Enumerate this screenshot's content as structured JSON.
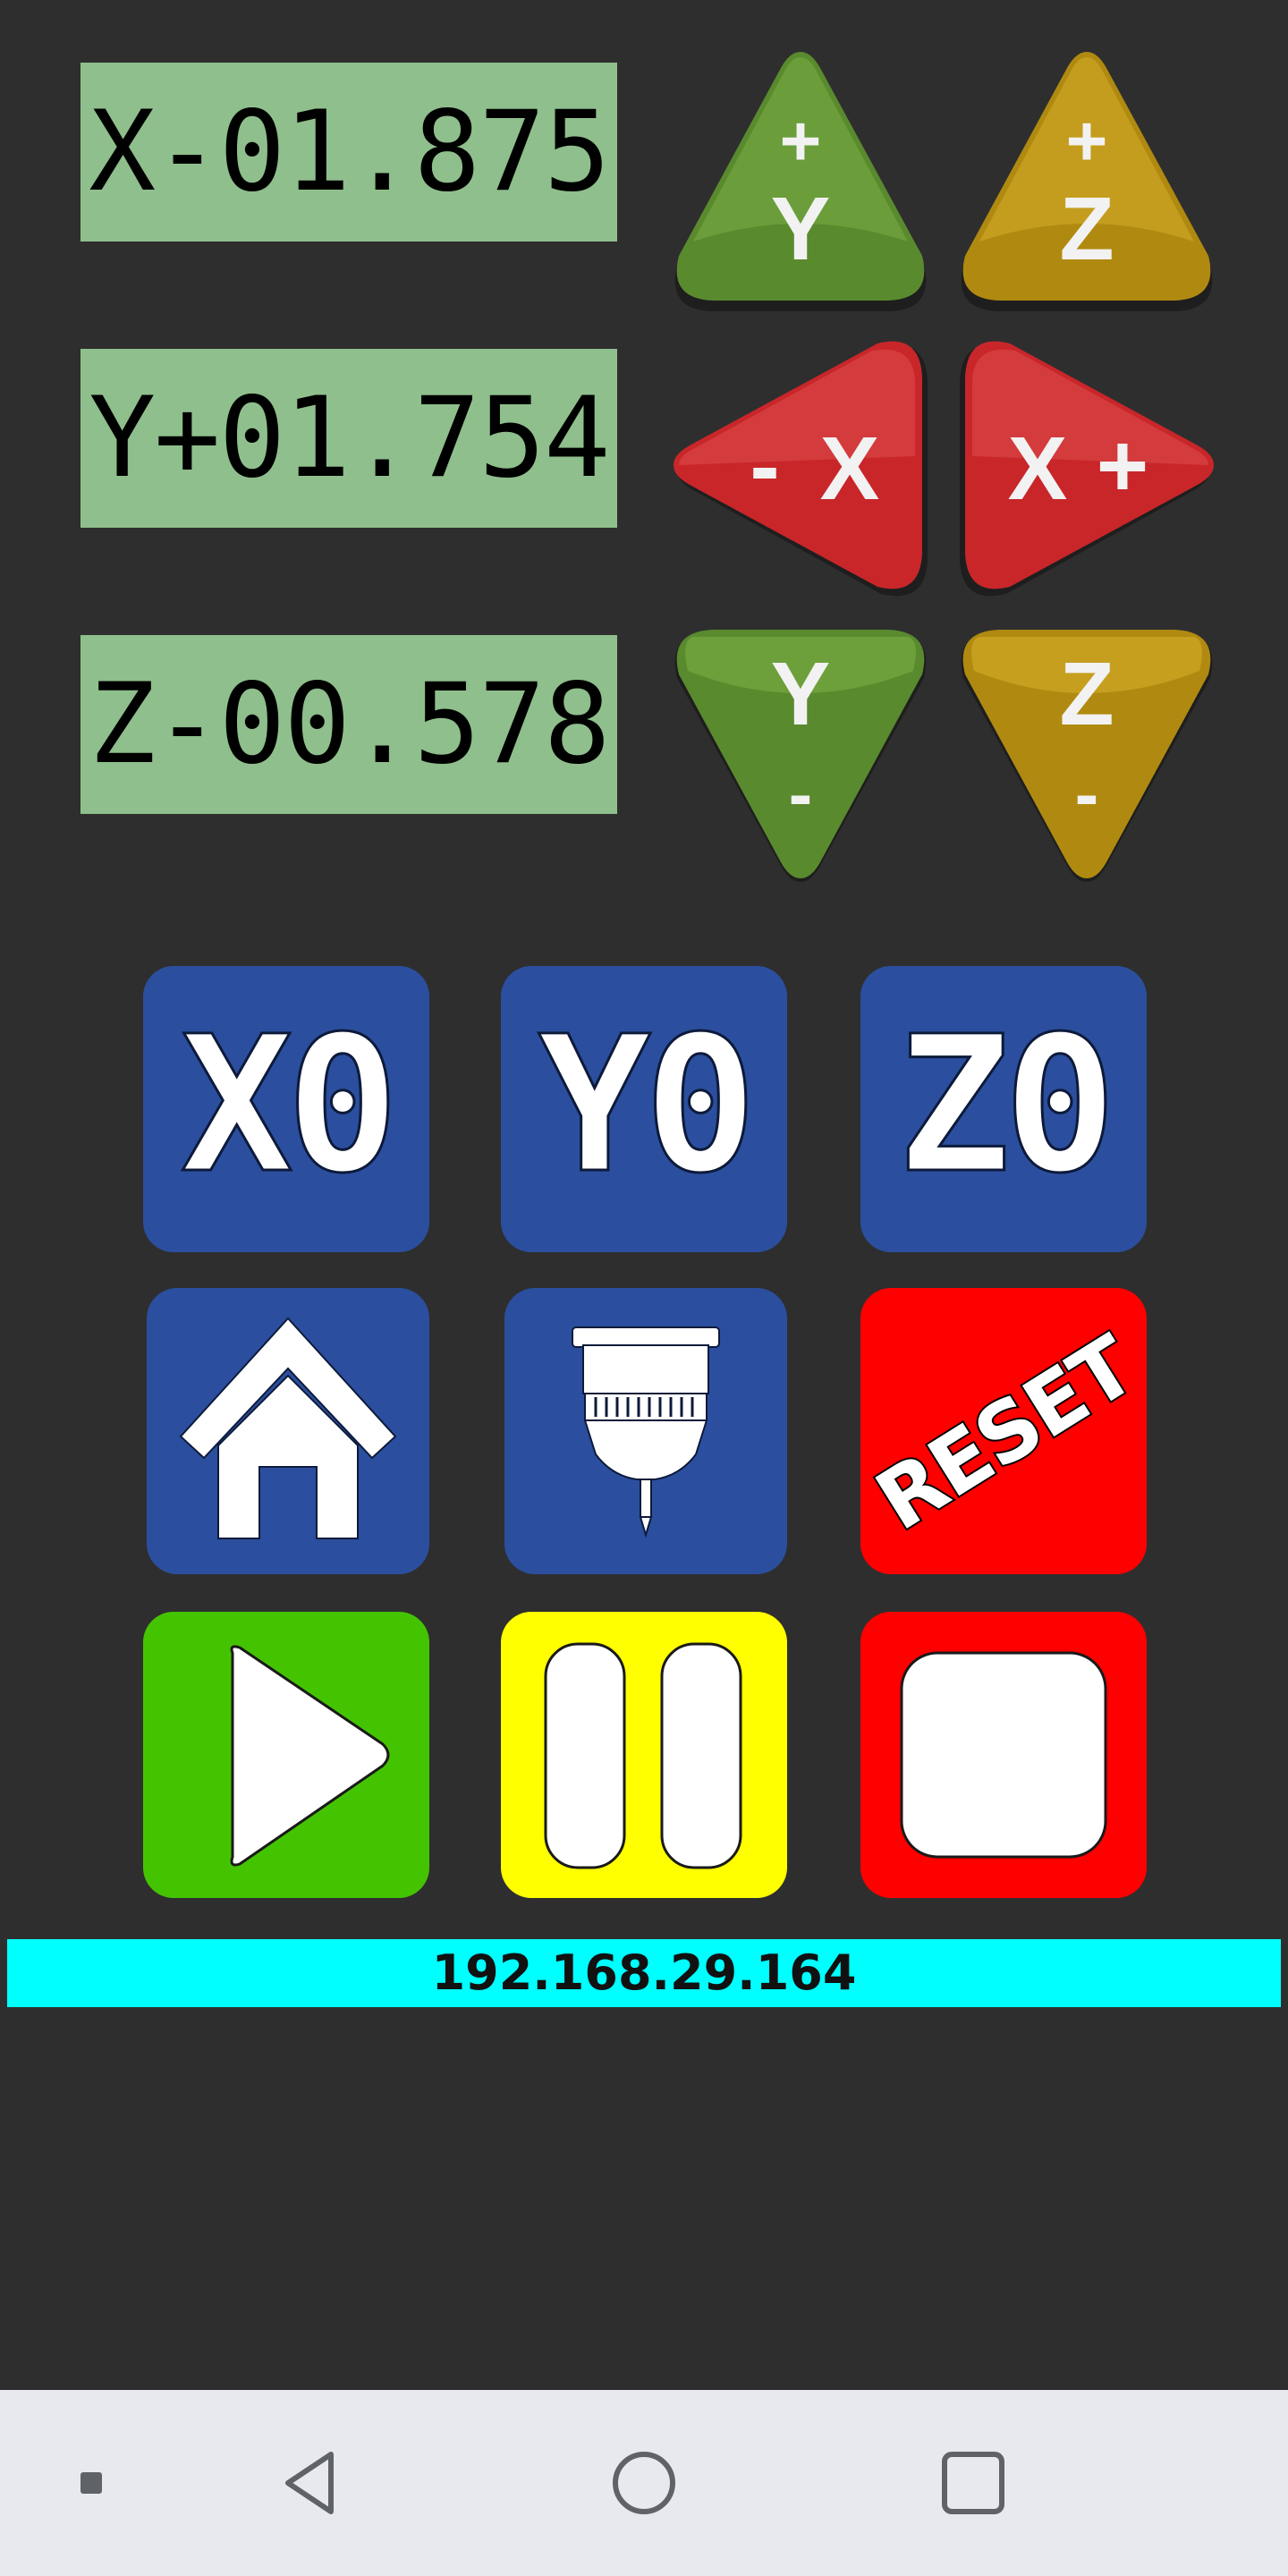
{
  "readouts": {
    "x": "X-01.875",
    "y": "Y+01.754",
    "z": "Z-00.578"
  },
  "jog": {
    "y_plus": {
      "sign": "+",
      "axis": "Y",
      "color": "#5a8a2e"
    },
    "z_plus": {
      "sign": "+",
      "axis": "Z",
      "color": "#b08a10"
    },
    "x_minus": {
      "sign": "-",
      "axis": "X",
      "color": "#c9262a"
    },
    "x_plus": {
      "sign": "+",
      "axis": "X",
      "color": "#c9262a"
    },
    "y_minus": {
      "sign": "-",
      "axis": "Y",
      "color": "#5a8a2e"
    },
    "z_minus": {
      "sign": "-",
      "axis": "Z",
      "color": "#b08a10"
    }
  },
  "zero_buttons": {
    "x0": "X0",
    "y0": "Y0",
    "z0": "Z0"
  },
  "actions": {
    "home_icon": "house-icon",
    "spindle_icon": "spindle-icon",
    "reset": "RESET"
  },
  "playback": {
    "play_icon": "play-icon",
    "pause_icon": "pause-icon",
    "stop_icon": "stop-icon"
  },
  "status": {
    "ip_address": "192.168.29.164"
  },
  "colors": {
    "background": "#2e2e2e",
    "readout_bg": "#8fbf8c",
    "tile_blue": "#2b4f9e",
    "reset_red": "#ff0000",
    "play_green": "#44c400",
    "pause_yellow": "#ffff00",
    "stop_red": "#ff0000",
    "ip_bar": "#00ffff"
  },
  "navbar": {
    "items": [
      "menu-icon",
      "back-icon",
      "home-icon",
      "recents-icon"
    ]
  }
}
